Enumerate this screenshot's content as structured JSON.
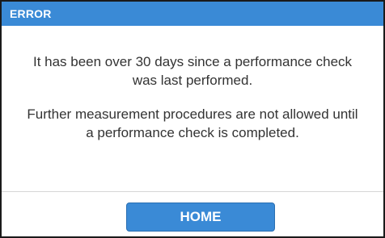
{
  "dialog": {
    "title": "ERROR",
    "message_paragraphs": [
      "It has been over 30 days since a performance check was last performed.",
      "Further measurement procedures are not allowed until a performance check is completed."
    ],
    "home_button_label": "HOME"
  },
  "colors": {
    "titlebar_bg": "#3a8ad6",
    "button_bg": "#3a8ad6",
    "text": "#333333"
  }
}
